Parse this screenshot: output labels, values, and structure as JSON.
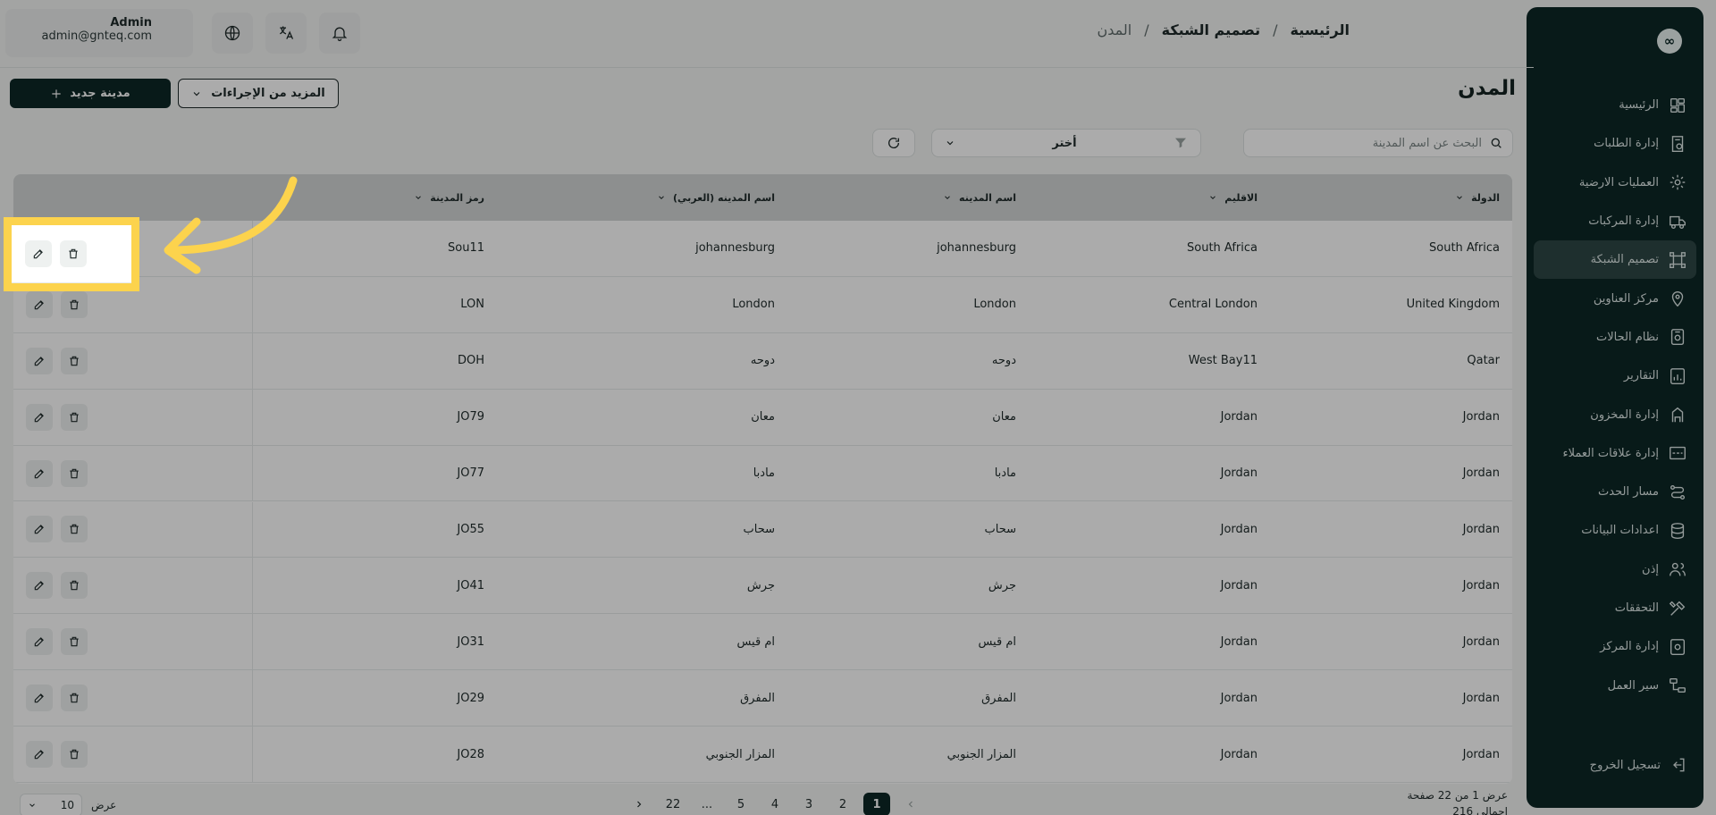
{
  "sidebar": {
    "logo": "∞",
    "items": [
      {
        "label": "الرئيسية",
        "icon": "dashboard-icon"
      },
      {
        "label": "إدارة الطلبات",
        "icon": "orders-icon"
      },
      {
        "label": "العمليات الارضية",
        "icon": "ground-operations-icon"
      },
      {
        "label": "إدارة المركبات",
        "icon": "truck-icon"
      },
      {
        "label": "تصميم الشبكة",
        "icon": "network-icon",
        "active": true
      },
      {
        "label": "مركز العناوين",
        "icon": "location-icon"
      },
      {
        "label": "نظام الحالات",
        "icon": "status-icon"
      },
      {
        "label": "التقارير",
        "icon": "reports-icon"
      },
      {
        "label": "إدارة المخزون",
        "icon": "warehouse-icon"
      },
      {
        "label": "إدارة علاقات العملاء",
        "icon": "crm-icon"
      },
      {
        "label": "مسار الحدث",
        "icon": "route-icon"
      },
      {
        "label": "اعدادات البيانات",
        "icon": "database-icon"
      },
      {
        "label": "إذن",
        "icon": "users-icon"
      },
      {
        "label": "التحققات",
        "icon": "tools-icon"
      },
      {
        "label": "إدارة المركز",
        "icon": "hub-icon"
      },
      {
        "label": "سير العمل",
        "icon": "workflow-icon"
      }
    ],
    "logout": "تسجيل الخروج"
  },
  "header": {
    "user_name": "Admin",
    "user_email": "admin@gnteq.com",
    "breadcrumb": [
      "الرئيسية",
      "تصميم الشبكة",
      "المدن"
    ],
    "separator": "/"
  },
  "page": {
    "title": "المدن",
    "new_button": "مدينة جديد",
    "more_actions": "المزيد من الإجراءات",
    "search_placeholder": "البحث عن اسم المدينة",
    "filter_label": "أختر"
  },
  "table": {
    "headers": {
      "country": "الدولة",
      "region": "الاقليم",
      "city_name": "اسم المدينه",
      "city_name_ar": "اسم المدينه (العربي)",
      "city_code": "رمز المدينة"
    },
    "rows": [
      {
        "country": "South Africa",
        "region": "South Africa",
        "city_name": "johannesburg",
        "city_name_ar": "johannesburg",
        "city_code": "Sou11"
      },
      {
        "country": "United Kingdom",
        "region": "Central London",
        "city_name": "London",
        "city_name_ar": "London",
        "city_code": "LON"
      },
      {
        "country": "Qatar",
        "region": "West Bay11",
        "city_name": "دوحه",
        "city_name_ar": "دوحه",
        "city_code": "DOH"
      },
      {
        "country": "Jordan",
        "region": "Jordan",
        "city_name": "معان",
        "city_name_ar": "معان",
        "city_code": "JO79"
      },
      {
        "country": "Jordan",
        "region": "Jordan",
        "city_name": "مادبا",
        "city_name_ar": "مادبا",
        "city_code": "JO77"
      },
      {
        "country": "Jordan",
        "region": "Jordan",
        "city_name": "سحاب",
        "city_name_ar": "سحاب",
        "city_code": "JO55"
      },
      {
        "country": "Jordan",
        "region": "Jordan",
        "city_name": "جرش",
        "city_name_ar": "جرش",
        "city_code": "JO41"
      },
      {
        "country": "Jordan",
        "region": "Jordan",
        "city_name": "ام قيس",
        "city_name_ar": "ام قيس",
        "city_code": "JO31"
      },
      {
        "country": "Jordan",
        "region": "Jordan",
        "city_name": "المفرق",
        "city_name_ar": "المفرق",
        "city_code": "JO29"
      },
      {
        "country": "Jordan",
        "region": "Jordan",
        "city_name": "المزار الجنوبي",
        "city_name_ar": "المزار الجنوبي",
        "city_code": "JO28"
      }
    ]
  },
  "pagination": {
    "pages": [
      "1",
      "2",
      "3",
      "4",
      "5",
      "...",
      "22"
    ],
    "current": "1",
    "info": "عرض 1 من 22 صفحة",
    "total": "اجمالي 216",
    "page_size_label": "عرض",
    "page_size": "10"
  },
  "colors": {
    "sidebar_bg": "#0d2726",
    "accent": "#0d2726",
    "highlight": "#fcd34d"
  }
}
